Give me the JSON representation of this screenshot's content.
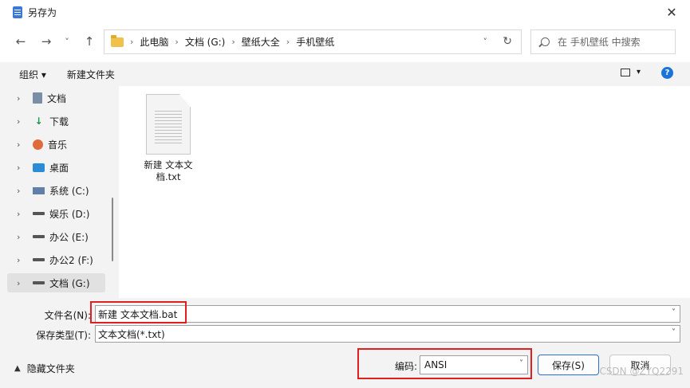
{
  "window": {
    "title": "另存为",
    "close_glyph": "✕"
  },
  "nav": {
    "back": "←",
    "forward": "→",
    "recent": "˅",
    "up": "↑",
    "breadcrumbs": [
      "此电脑",
      "文档 (G:)",
      "壁纸大全",
      "手机壁纸"
    ],
    "separator": "›",
    "dropdown_glyph": "˅",
    "refresh_glyph": "↻",
    "search_placeholder": "在 手机壁纸 中搜索"
  },
  "toolbar": {
    "organize_label": "组织 ▾",
    "new_folder_label": "新建文件夹",
    "view_chevron": "▾",
    "help_glyph": "?"
  },
  "sidebar": {
    "items": [
      {
        "label": "文档",
        "icon": "documents-icon"
      },
      {
        "label": "下载",
        "icon": "download-icon"
      },
      {
        "label": "音乐",
        "icon": "music-icon"
      },
      {
        "label": "桌面",
        "icon": "desktop-icon"
      },
      {
        "label": "系统 (C:)",
        "icon": "system-drive-icon"
      },
      {
        "label": "娱乐 (D:)",
        "icon": "drive-icon"
      },
      {
        "label": "办公 (E:)",
        "icon": "drive-icon"
      },
      {
        "label": "办公2 (F:)",
        "icon": "drive-icon"
      },
      {
        "label": "文档 (G:)",
        "icon": "drive-icon"
      }
    ],
    "selected_index": 8,
    "chevron": "›"
  },
  "files": [
    {
      "name": "新建 文本文档.txt",
      "icon": "text-file-icon"
    }
  ],
  "form": {
    "filename_label": "文件名(N):",
    "filename_value": "新建 文本文档.bat",
    "filetype_label": "保存类型(T):",
    "filetype_value": "文本文档(*.txt)",
    "hide_folders_label": "隐藏文件夹",
    "encoding_label": "编码:",
    "encoding_value": "ANSI",
    "save_label": "保存(S)",
    "cancel_label": "取消",
    "dropdown_glyph": "˅"
  },
  "watermark": "CSDN @ZYQ2291",
  "colors": {
    "accent": "#2a6fd6",
    "highlight_box": "#e02020",
    "help_icon": "#1a73d9"
  }
}
